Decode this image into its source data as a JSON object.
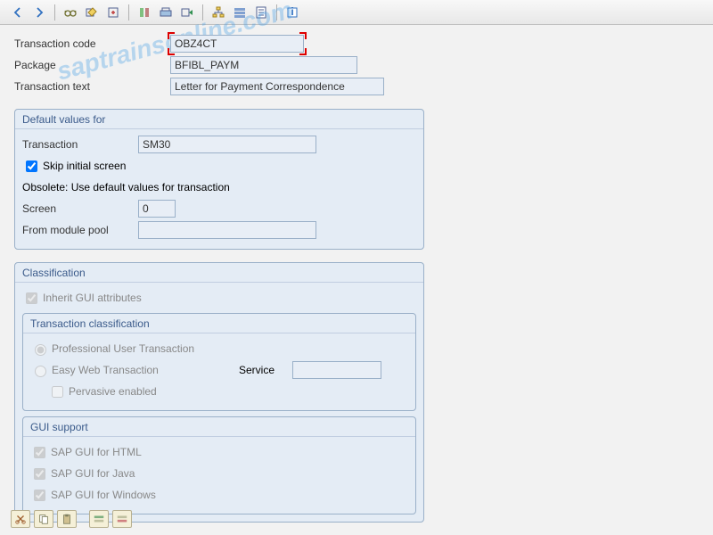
{
  "toolbar": {},
  "header": {
    "tcode_label": "Transaction code",
    "tcode_value": "OBZ4CT",
    "package_label": "Package",
    "package_value": "BFIBL_PAYM",
    "ttext_label": "Transaction text",
    "ttext_value": "Letter for Payment Correspondence"
  },
  "defaults": {
    "title": "Default values for",
    "transaction_label": "Transaction",
    "transaction_value": "SM30",
    "skip_label": "Skip initial screen",
    "obsolete": "Obsolete: Use default values for transaction",
    "screen_label": "Screen",
    "screen_value": "0",
    "pool_label": "From module pool",
    "pool_value": ""
  },
  "classification": {
    "title": "Classification",
    "inherit_label": "Inherit GUI attributes",
    "tc_title": "Transaction classification",
    "prof_label": "Professional User Transaction",
    "easy_label": "Easy Web Transaction",
    "service_label": "Service",
    "pervasive_label": "Pervasive enabled",
    "gui_title": "GUI support",
    "gui_html": "SAP GUI for HTML",
    "gui_java": "SAP GUI for Java",
    "gui_win": "SAP GUI for Windows"
  },
  "watermark": "saptrainsonline.com"
}
